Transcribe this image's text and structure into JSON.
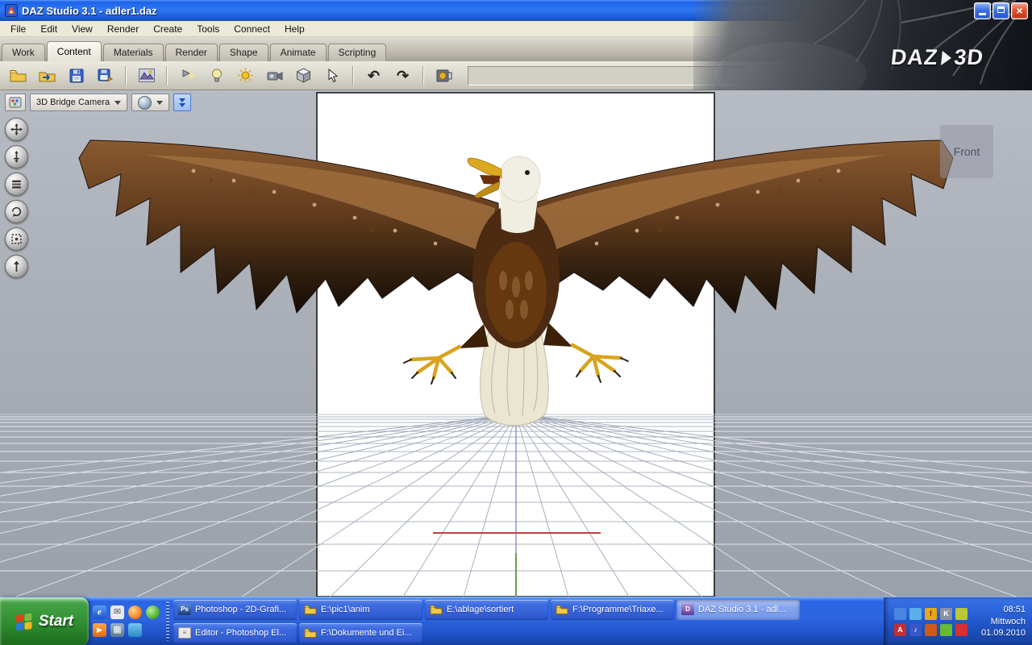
{
  "window": {
    "title": "DAZ Studio 3.1  - adler1.daz"
  },
  "titlebar": {
    "close_glyph": "×",
    "buttons": [
      "minimize",
      "maximize",
      "close"
    ]
  },
  "menubar": {
    "items": [
      {
        "label": "File"
      },
      {
        "label": "Edit"
      },
      {
        "label": "View"
      },
      {
        "label": "Render"
      },
      {
        "label": "Create"
      },
      {
        "label": "Tools"
      },
      {
        "label": "Connect"
      },
      {
        "label": "Help"
      }
    ]
  },
  "tabs": {
    "active": "Content",
    "items": [
      {
        "label": "Work"
      },
      {
        "label": "Content"
      },
      {
        "label": "Materials"
      },
      {
        "label": "Render"
      },
      {
        "label": "Shape"
      },
      {
        "label": "Animate"
      },
      {
        "label": "Scripting"
      }
    ]
  },
  "brand": {
    "daz": "DAZ",
    "threed": "3D"
  },
  "toolbar": {
    "icons": [
      "open-file",
      "import-file",
      "save",
      "save-as",
      "3d-bridge",
      "spotlight",
      "point-light",
      "sun-light",
      "camera",
      "primitive-cube",
      "pointer-tool",
      "undo",
      "redo",
      "render"
    ],
    "undo_glyph": "↶",
    "redo_glyph": "↷"
  },
  "viewport": {
    "camera_selector": {
      "label": "3D Bridge Camera"
    },
    "view_label": "Front",
    "nav": {
      "icons": [
        "pan",
        "dolly",
        "layers",
        "orbit",
        "frame",
        "aim"
      ]
    },
    "scene": {
      "model": "eagle",
      "backdrop": "white",
      "grid": "perspective-floor"
    }
  },
  "taskbar": {
    "start": {
      "label": "Start"
    },
    "quick_launch": {
      "icons": [
        {
          "name": "internet-explorer",
          "glyph": "e"
        },
        {
          "name": "mail",
          "glyph": "✉"
        },
        {
          "name": "firefox",
          "glyph": ""
        },
        {
          "name": "messenger",
          "glyph": ""
        },
        {
          "name": "media-player",
          "glyph": "▶"
        },
        {
          "name": "photo-viewer",
          "glyph": "▦"
        },
        {
          "name": "show-desktop",
          "glyph": ""
        }
      ]
    },
    "buttons_row1": [
      {
        "label": "Photoshop - 2D-Grafi...",
        "icon": "photoshop"
      },
      {
        "label": "E:\\pic1\\anim",
        "icon": "folder"
      },
      {
        "label": "E:\\ablage\\sortiert",
        "icon": "folder"
      },
      {
        "label": "F:\\Programme\\Triaxe...",
        "icon": "folder"
      },
      {
        "label": "DAZ Studio 3.1  - adl...",
        "icon": "daz-studio",
        "active": true
      }
    ],
    "buttons_row2": [
      {
        "label": "Editor - Photoshop El...",
        "icon": "editor"
      },
      {
        "label": "F:\\Dokumente und Ei...",
        "icon": "folder"
      }
    ],
    "tray": {
      "icons": [
        {
          "name": "display-settings",
          "glyph": ""
        },
        {
          "name": "network",
          "glyph": ""
        },
        {
          "name": "update-alert",
          "glyph": "!"
        },
        {
          "name": "language-indicator",
          "glyph": "K"
        },
        {
          "name": "security-shield",
          "glyph": ""
        },
        {
          "name": "antivirus",
          "glyph": "A"
        },
        {
          "name": "volume",
          "glyph": "♪"
        },
        {
          "name": "scanner",
          "glyph": ""
        },
        {
          "name": "graphics-driver",
          "glyph": ""
        },
        {
          "name": "alert",
          "glyph": ""
        }
      ],
      "clock": {
        "time": "08:51",
        "weekday": "Mittwoch",
        "date": "01.09.2010"
      }
    }
  }
}
